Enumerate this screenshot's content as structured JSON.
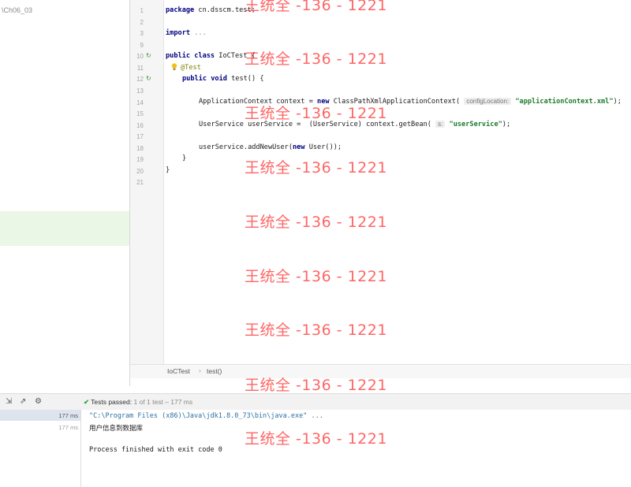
{
  "project": {
    "path": "\\Ch06_03"
  },
  "editor": {
    "lines": [
      {
        "n": "1",
        "text": "package cn.dsscm.test;"
      },
      {
        "n": "2",
        "text": ""
      },
      {
        "n": "3",
        "text": "import ..."
      },
      {
        "n": "9",
        "text": ""
      },
      {
        "n": "10",
        "text": "public class IoCTest {"
      },
      {
        "n": "11",
        "text": "@Test"
      },
      {
        "n": "12",
        "text": "public void test() {"
      },
      {
        "n": "13",
        "text": ""
      },
      {
        "n": "14",
        "text": "ApplicationContext context = new ClassPathXmlApplicationContext( configLocation: \"applicationContext.xml\");"
      },
      {
        "n": "15",
        "text": ""
      },
      {
        "n": "16",
        "text": "UserService userService =  (UserService) context.getBean( s: \"userService\");"
      },
      {
        "n": "17",
        "text": ""
      },
      {
        "n": "18",
        "text": "userService.addNewUser(new User());"
      },
      {
        "n": "19",
        "text": "}"
      },
      {
        "n": "20",
        "text": "}"
      },
      {
        "n": "21",
        "text": ""
      }
    ],
    "tokens": {
      "kw_package": "package",
      "pkg_name": " cn.dsscm.test;",
      "kw_import": "import",
      "import_rest": " ...",
      "kw_public": "public",
      "kw_class": "class",
      "class_name": " IoCTest {",
      "annotation": "@Test",
      "kw_void": "void",
      "method_sig": " test() {",
      "l14_a": "ApplicationContext context = ",
      "kw_new": "new",
      "l14_b": " ClassPathXmlApplicationContext(",
      "l14_hint": "configLocation:",
      "l14_str": "\"applicationContext.xml\"",
      "l14_end": ");",
      "l16_a": "UserService userService =  (UserService) context.getBean(",
      "l16_hint": "s:",
      "l16_str": "\"userService\"",
      "l16_end": ");",
      "l18_a": "userService.addNewUser(",
      "l18_b": " User());",
      "brace_close": "}"
    }
  },
  "breadcrumb": {
    "class": "IoCTest",
    "separator": "›",
    "method": "test()"
  },
  "run_panel": {
    "status_label": "Tests passed:",
    "status_counts": "1 of 1 test – 177 ms",
    "tree_times": [
      "177 ms",
      "177 ms"
    ],
    "console_lines": [
      "\"C:\\Program Files (x86)\\Java\\jdk1.8.0_73\\bin\\java.exe\" ...",
      "用户信息到数据库",
      "Process finished with exit code 0"
    ]
  },
  "watermark": {
    "text": "王统全 -136 - 1221"
  },
  "icons": {
    "run_gutter": "run-gutter-icon",
    "bulb": "lightbulb-icon",
    "check": "check-icon",
    "sort": "sort-icon",
    "export": "export-icon",
    "settings": "gear-icon"
  }
}
